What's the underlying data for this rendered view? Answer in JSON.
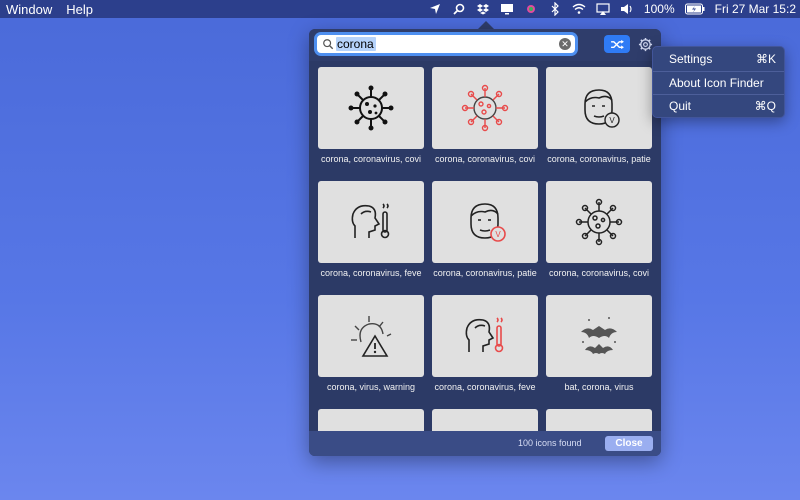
{
  "menubar": {
    "items": [
      "Window",
      "Help"
    ],
    "battery": "100%",
    "clock": "Fri 27 Mar  15:2"
  },
  "search": {
    "value": "corona",
    "placeholder": ""
  },
  "icons": [
    {
      "caption": "corona, coronavirus, covi",
      "icon": "virus-icon",
      "color": "#000000"
    },
    {
      "caption": "corona, coronavirus, covi",
      "icon": "virus-icon",
      "color": "#e84a4a"
    },
    {
      "caption": "corona, coronavirus, patie",
      "icon": "patient-face-icon",
      "color": "#000000"
    },
    {
      "caption": "corona, coronavirus, feve",
      "icon": "fever-thermometer-icon",
      "color": "#000000"
    },
    {
      "caption": "corona, coronavirus, patie",
      "icon": "patient-face-icon",
      "color": "#e84a4a"
    },
    {
      "caption": "corona, coronavirus, covi",
      "icon": "virus-icon",
      "color": "#000000"
    },
    {
      "caption": "corona, virus, warning",
      "icon": "virus-warning-icon",
      "color": "#000000"
    },
    {
      "caption": "corona, coronavirus, feve",
      "icon": "fever-thermometer-icon",
      "color": "#e84a4a"
    },
    {
      "caption": "bat, corona, virus",
      "icon": "bats-icon",
      "color": "#555555"
    }
  ],
  "footer": {
    "count": "100 icons found",
    "close_label": "Close"
  },
  "menu": {
    "settings": "Settings",
    "settings_shortcut": "⌘K",
    "about": "About Icon Finder",
    "quit": "Quit",
    "quit_shortcut": "⌘Q"
  }
}
